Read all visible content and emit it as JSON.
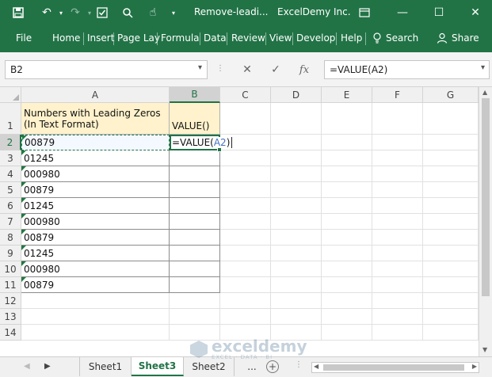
{
  "titlebar": {
    "doc_title": "Remove-leadi...",
    "account": "ExcelDemy Inc."
  },
  "ribbon": {
    "tabs": [
      "File",
      "Home",
      "Insert",
      "Page Lay",
      "Formula",
      "Data",
      "Review",
      "View",
      "Develop",
      "Help"
    ],
    "search_label": "Search",
    "share_label": "Share"
  },
  "formula_bar": {
    "name_box": "B2",
    "formula": "=VALUE(A2)"
  },
  "grid": {
    "columns": [
      "A",
      "B",
      "C",
      "D",
      "E",
      "F",
      "G"
    ],
    "rows": [
      "1",
      "2",
      "3",
      "4",
      "5",
      "6",
      "7",
      "8",
      "9",
      "10",
      "11",
      "12",
      "13",
      "14"
    ],
    "a1_line1": "Numbers with Leading Zeros",
    "a1_line2": "(In Text Format)",
    "b1": "VALUE()",
    "a_values": [
      "00879",
      "01245",
      "000980",
      "00879",
      "01245",
      "000980",
      "00879",
      "01245",
      "000980",
      "00879"
    ],
    "b2_prefix": "=VALUE(",
    "b2_ref": "A2",
    "b2_suffix": ")"
  },
  "sheets": {
    "tabs": [
      "Sheet1",
      "Sheet3",
      "Sheet2"
    ],
    "active": "Sheet3",
    "more": "..."
  },
  "watermark": {
    "name": "exceldemy",
    "tagline": "EXCEL · DATA · BI"
  },
  "colors": {
    "excel_green": "#217346",
    "header_fill": "#fff2cc",
    "ref_blue": "#4472c4"
  }
}
